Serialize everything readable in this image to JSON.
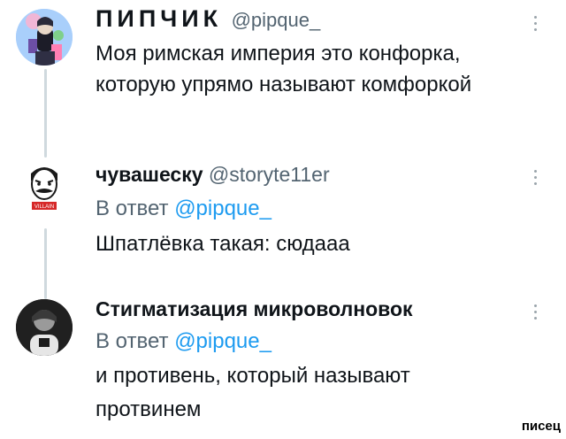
{
  "tweets": [
    {
      "display_name": "ПИПЧИК",
      "handle": "@pipque_",
      "text_lines": [
        "Моя римская империя это конфорка,",
        "которую упрямо называют комфоркой"
      ]
    },
    {
      "display_name": "чувашеску",
      "handle": "@storyte11er",
      "reply_prefix": "В ответ ",
      "reply_mention": "@pipque_",
      "text_lines": [
        "Шпатлёвка такая: сюдааа"
      ],
      "avatar_caption": "VILLAIN"
    },
    {
      "display_name": "Стигматизация микроволновок",
      "handle": "",
      "reply_prefix": "В ответ ",
      "reply_mention": "@pipque_",
      "text_lines": [
        "и противень, который называют",
        "протвинем"
      ]
    }
  ],
  "watermark": "писец",
  "colors": {
    "thread_line": "#cfd9de",
    "mention": "#1d9bf0",
    "muted": "#536471",
    "text": "#0f1419"
  }
}
